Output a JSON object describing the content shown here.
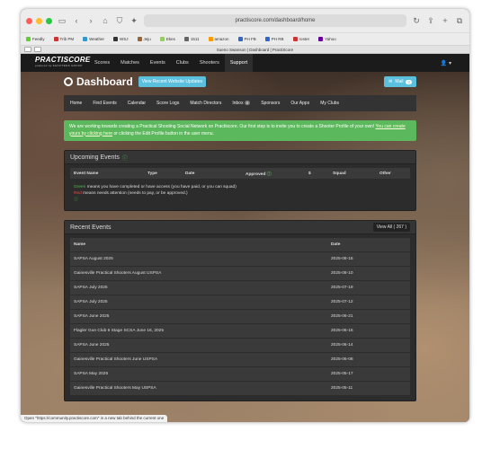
{
  "browser": {
    "url": "practiscore.com/dashboard/home",
    "bookmarks": [
      "Feedly",
      "Trib PM",
      "Weather",
      "WSJ",
      "Jeju",
      "Ekes",
      "1511",
      "amazon",
      "PH FB",
      "PH RB",
      "roster",
      "Yahoo"
    ],
    "tab_title": "Sueno Swanson | Dashboard | PractiScore",
    "status": "Open \"https://community.practiscore.com\" in a new tab behind the current one"
  },
  "topnav": {
    "logo": "PRACTISCORE",
    "logo_sub": "powered by SHOOTERS GROUP",
    "items": [
      "Scores",
      "Matches",
      "Events",
      "Clubs",
      "Shooters",
      "Support"
    ]
  },
  "header": {
    "title": "Dashboard",
    "updates_button": "View Recent Website Updates",
    "mail_label": "Mail",
    "mail_count": "0"
  },
  "subnav": {
    "items": [
      "Home",
      "Find Events",
      "Calendar",
      "Score Logs",
      "Match Directors",
      "Inbox",
      "Sponsors",
      "Our Apps",
      "My Clubs"
    ],
    "inbox_count": "0"
  },
  "alert": {
    "text": "We are working towards creating a Practical Shooting Social Network on Practiscore. Our first step is to invite you to create a Shooter Profile of your own!",
    "link1": "You can create yours by clicking here",
    "text2": "or clicking the Edit Profile button in the user menu."
  },
  "upcoming": {
    "title": "Upcoming Events",
    "columns": [
      "Event Name",
      "Type",
      "Date",
      "Approved",
      "$",
      "Squad",
      "Other"
    ],
    "legend_green_word": "Green",
    "legend_green_rest": "means you have completed or have access (you have paid, or you can squad)",
    "legend_red_word": "Red",
    "legend_red_rest": "means needs attention (needs to pay, or be approved.)"
  },
  "recent": {
    "title": "Recent Events",
    "view_all": "View All ( 267 )",
    "columns": [
      "Name",
      "Date"
    ],
    "rows": [
      {
        "name": "SAPSA August 2025",
        "date": "2025-08-15"
      },
      {
        "name": "Gainesville Practical Shooters August USPSA",
        "date": "2025-08-10"
      },
      {
        "name": "SAPSA July 2025",
        "date": "2025-07-19"
      },
      {
        "name": "SAPSA July 2025",
        "date": "2025-07-12"
      },
      {
        "name": "SAPSA June 2025",
        "date": "2025-06-21"
      },
      {
        "name": "Flagler Gun Club 6 Stage SCSA June 16, 2025",
        "date": "2025-06-16"
      },
      {
        "name": "SAPSA June 2025",
        "date": "2025-06-14"
      },
      {
        "name": "Gainesville Practical Shooters June USPSA",
        "date": "2025-06-08"
      },
      {
        "name": "SAPSA May 2025",
        "date": "2025-05-17"
      },
      {
        "name": "Gainesville Practical Shooters May USPSA",
        "date": "2025-05-11"
      }
    ]
  }
}
